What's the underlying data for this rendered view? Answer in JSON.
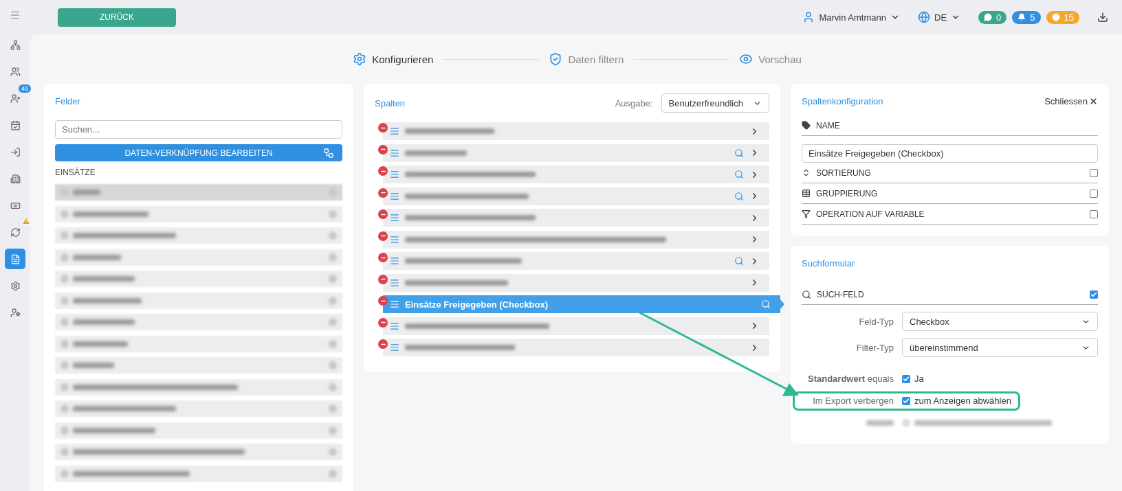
{
  "topbar": {
    "back_button": "ZURÜCK",
    "user": "Marvin Amtmann",
    "language": "DE",
    "counters": [
      {
        "kind": "messages",
        "count": "0",
        "color": "#3aa68d"
      },
      {
        "kind": "notifications",
        "count": "5",
        "color": "#2f8fe0"
      },
      {
        "kind": "time",
        "count": "15",
        "color": "#f7a531"
      }
    ]
  },
  "sidebar": {
    "items": [
      {
        "selected": false
      },
      {
        "selected": false
      },
      {
        "selected": false,
        "badge": "46"
      },
      {
        "selected": false
      },
      {
        "selected": false
      },
      {
        "selected": false
      },
      {
        "selected": false
      },
      {
        "selected": false,
        "warning": true
      },
      {
        "selected": true
      },
      {
        "selected": false
      },
      {
        "selected": false
      }
    ]
  },
  "steps": [
    {
      "label": "Konfigurieren",
      "active": true
    },
    {
      "label": "Daten filtern",
      "active": false
    },
    {
      "label": "Vorschau",
      "active": false
    }
  ],
  "fields_panel": {
    "title": "Felder",
    "search": {
      "placeholder": "Suchen..."
    },
    "edit_button": "DATEN-VERKNÜPFUNG BEARBEITEN",
    "group": "EINSÄTZE",
    "items": [
      {
        "selected": true
      },
      {
        "selected": false
      },
      {
        "selected": false
      },
      {
        "selected": false
      },
      {
        "selected": false
      },
      {
        "selected": false
      },
      {
        "selected": false
      },
      {
        "selected": false
      },
      {
        "selected": false
      },
      {
        "selected": false
      },
      {
        "selected": false
      },
      {
        "selected": false
      },
      {
        "selected": false
      },
      {
        "selected": false
      }
    ]
  },
  "columns_panel": {
    "title": "Spalten",
    "output_label": "Ausgabe:",
    "output": "Benutzerfreundlich",
    "rows": [
      {
        "kind": "redacted",
        "searchable": false,
        "selected": false
      },
      {
        "kind": "redacted",
        "searchable": true,
        "selected": false
      },
      {
        "kind": "redacted",
        "searchable": true,
        "selected": false
      },
      {
        "kind": "redacted",
        "searchable": true,
        "selected": false
      },
      {
        "kind": "redacted",
        "searchable": false,
        "selected": false
      },
      {
        "kind": "redacted",
        "searchable": false,
        "selected": false
      },
      {
        "kind": "redacted",
        "searchable": true,
        "selected": false
      },
      {
        "kind": "redacted",
        "searchable": false,
        "selected": false
      },
      {
        "kind": "text",
        "label": "Einsätze Freigegeben (Checkbox)",
        "searchable": true,
        "selected": true
      },
      {
        "kind": "redacted",
        "searchable": false,
        "selected": false
      },
      {
        "kind": "redacted",
        "searchable": false,
        "selected": false
      }
    ]
  },
  "config_panel": {
    "title": "Spaltenkonfiguration",
    "close": "Schliessen",
    "name_label": "NAME",
    "name_value": "Einsätze Freigegeben (Checkbox)",
    "options": [
      {
        "label": "SORTIERUNG",
        "checked": false
      },
      {
        "label": "GRUPPIERUNG",
        "checked": false
      },
      {
        "label": "OPERATION AUF VARIABLE",
        "checked": false
      }
    ]
  },
  "search_panel": {
    "title": "Suchformular",
    "search_field": {
      "label": "SUCH-FELD",
      "checked": true
    },
    "selects": [
      {
        "label": "Feld-Typ",
        "value": "Checkbox"
      },
      {
        "label": "Filter-Typ",
        "value": "übereinstimmend"
      }
    ],
    "checks": [
      {
        "kind": "text",
        "label": "**Standardwert** equals",
        "text": "Ja",
        "checked": true,
        "highlighted": false
      },
      {
        "kind": "text",
        "label": "Im Export verbergen",
        "text": "zum Anzeigen abwählen",
        "checked": true,
        "highlighted": true
      },
      {
        "kind": "redacted",
        "checked": false
      }
    ]
  }
}
